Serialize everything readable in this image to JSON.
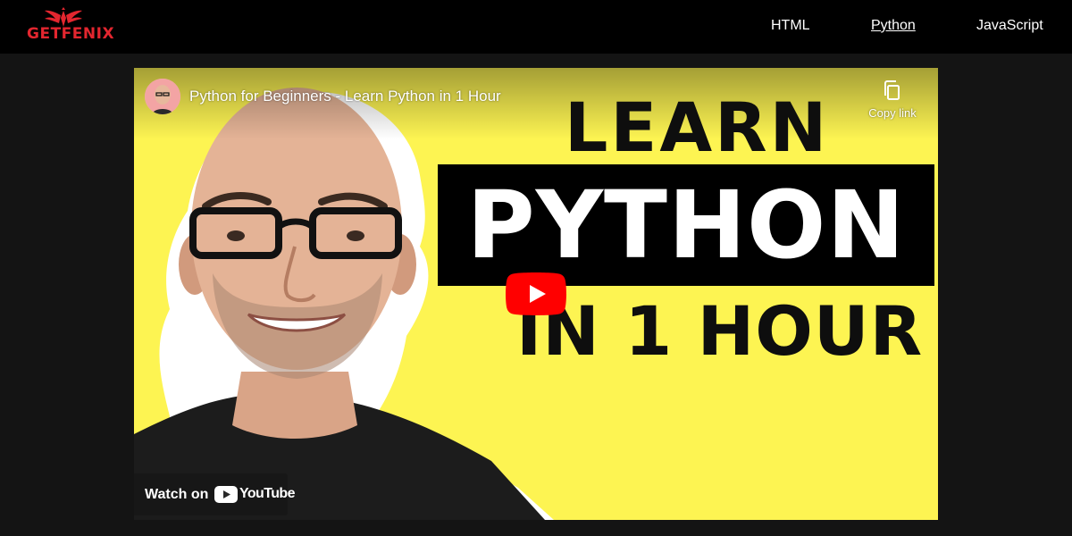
{
  "brand": {
    "name": "GETFENIX",
    "accent_color": "#e3262f"
  },
  "nav": {
    "items": [
      {
        "label": "HTML",
        "active": false
      },
      {
        "label": "Python",
        "active": true
      },
      {
        "label": "JavaScript",
        "active": false
      }
    ]
  },
  "video": {
    "title": "Python for Beginners - Learn Python in 1 Hour",
    "copy_link_label": "Copy link",
    "copy_icon": "copy-icon",
    "play_icon": "youtube-play-icon",
    "thumbnail": {
      "line1": "LEARN",
      "line2": "PYTHON",
      "line3": "IN 1 HOUR",
      "background_color": "#fdf452"
    },
    "watch_on_label": "Watch on",
    "platform_name": "YouTube",
    "platform_color": "#ff0000"
  }
}
